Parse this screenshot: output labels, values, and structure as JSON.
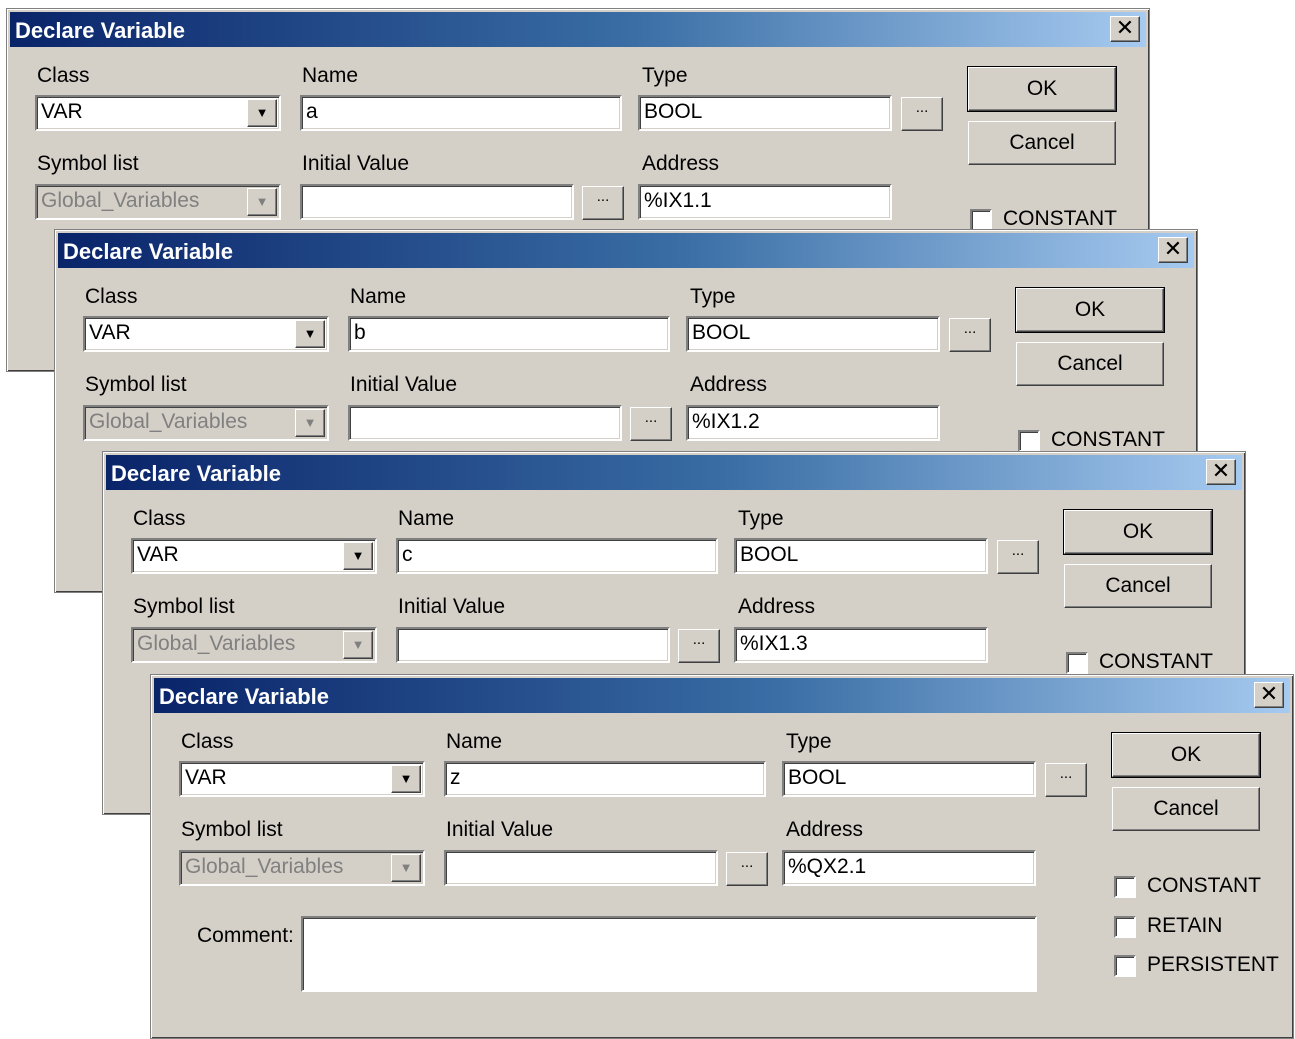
{
  "dialogs": [
    {
      "title": "Declare Variable",
      "labels": {
        "class": "Class",
        "name": "Name",
        "type": "Type",
        "symbol_list": "Symbol list",
        "initial_value": "Initial Value",
        "address": "Address"
      },
      "class_value": "VAR",
      "name_value": "a",
      "type_value": "BOOL",
      "symbol_list_value": "Global_Variables",
      "initial_value": "",
      "address_value": "%IX1.1",
      "ok_label": "OK",
      "cancel_label": "Cancel",
      "ellipsis": "...",
      "constant_label": "CONSTANT"
    },
    {
      "title": "Declare Variable",
      "labels": {
        "class": "Class",
        "name": "Name",
        "type": "Type",
        "symbol_list": "Symbol list",
        "initial_value": "Initial Value",
        "address": "Address"
      },
      "class_value": "VAR",
      "name_value": "b",
      "type_value": "BOOL",
      "symbol_list_value": "Global_Variables",
      "initial_value": "",
      "address_value": "%IX1.2",
      "ok_label": "OK",
      "cancel_label": "Cancel",
      "ellipsis": "...",
      "constant_label": "CONSTANT"
    },
    {
      "title": "Declare Variable",
      "labels": {
        "class": "Class",
        "name": "Name",
        "type": "Type",
        "symbol_list": "Symbol list",
        "initial_value": "Initial Value",
        "address": "Address"
      },
      "class_value": "VAR",
      "name_value": "c",
      "type_value": "BOOL",
      "symbol_list_value": "Global_Variables",
      "initial_value": "",
      "address_value": "%IX1.3",
      "ok_label": "OK",
      "cancel_label": "Cancel",
      "ellipsis": "...",
      "constant_label": "CONSTANT"
    },
    {
      "title": "Declare Variable",
      "labels": {
        "class": "Class",
        "name": "Name",
        "type": "Type",
        "symbol_list": "Symbol list",
        "initial_value": "Initial Value",
        "address": "Address",
        "comment": "Comment:"
      },
      "class_value": "VAR",
      "name_value": "z",
      "type_value": "BOOL",
      "symbol_list_value": "Global_Variables",
      "initial_value": "",
      "address_value": "%QX2.1",
      "comment_value": "",
      "ok_label": "OK",
      "cancel_label": "Cancel",
      "ellipsis": "...",
      "constant_label": "CONSTANT",
      "retain_label": "RETAIN",
      "persistent_label": "PERSISTENT"
    }
  ]
}
